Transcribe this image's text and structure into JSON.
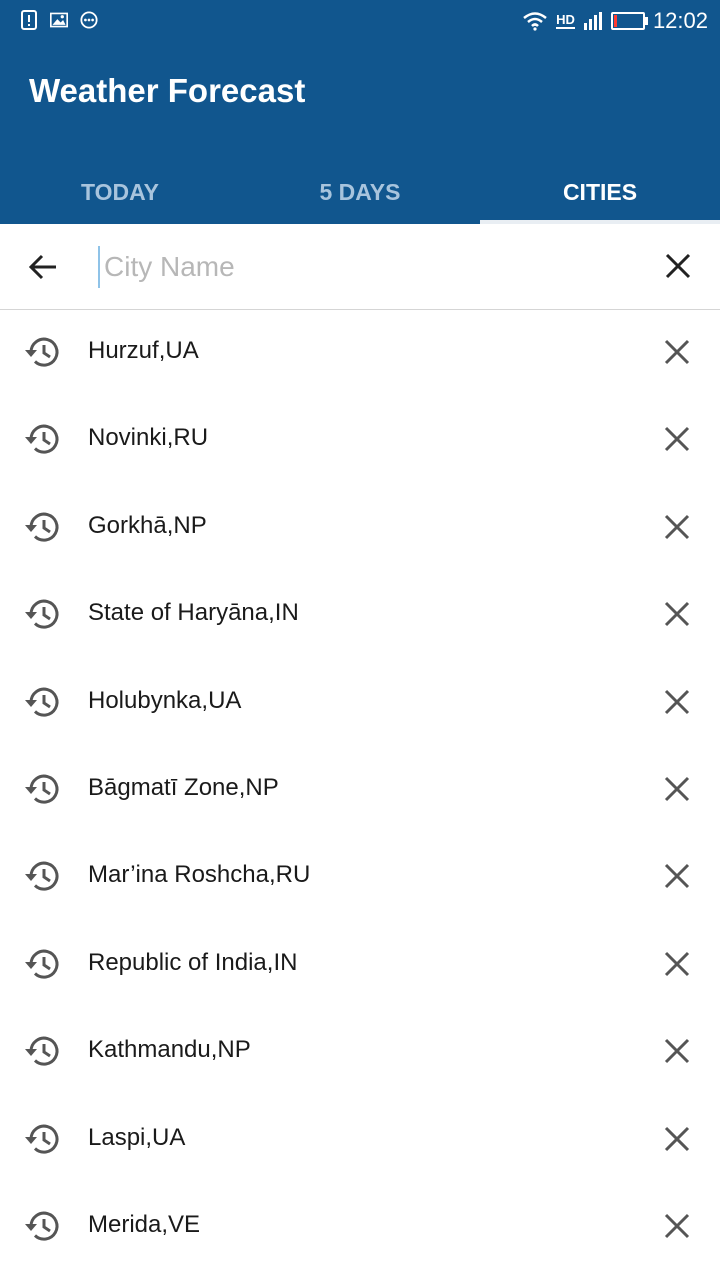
{
  "status_bar": {
    "time": "12:02",
    "network": "HD",
    "icons": [
      "alert-icon",
      "image-icon",
      "more-dots-icon",
      "wifi-icon",
      "hd-icon",
      "signal-icon",
      "battery-icon"
    ]
  },
  "app": {
    "title": "Weather Forecast",
    "tabs": [
      {
        "label": "TODAY",
        "active": false
      },
      {
        "label": "5 DAYS",
        "active": false
      },
      {
        "label": "CITIES",
        "active": true
      }
    ]
  },
  "search": {
    "placeholder": "City Name",
    "value": ""
  },
  "recent_cities": [
    {
      "name": "Hurzuf,UA"
    },
    {
      "name": "Novinki,RU"
    },
    {
      "name": "Gorkhā,NP"
    },
    {
      "name": "State of Haryāna,IN"
    },
    {
      "name": "Holubynka,UA"
    },
    {
      "name": "Bāgmatī Zone,NP"
    },
    {
      "name": "Mar’ina Roshcha,RU"
    },
    {
      "name": "Republic of India,IN"
    },
    {
      "name": "Kathmandu,NP"
    },
    {
      "name": "Laspi,UA"
    },
    {
      "name": "Merida,VE"
    }
  ],
  "colors": {
    "primary": "#11568e",
    "tab_inactive": "#a8c4dd",
    "icon": "#555555"
  }
}
